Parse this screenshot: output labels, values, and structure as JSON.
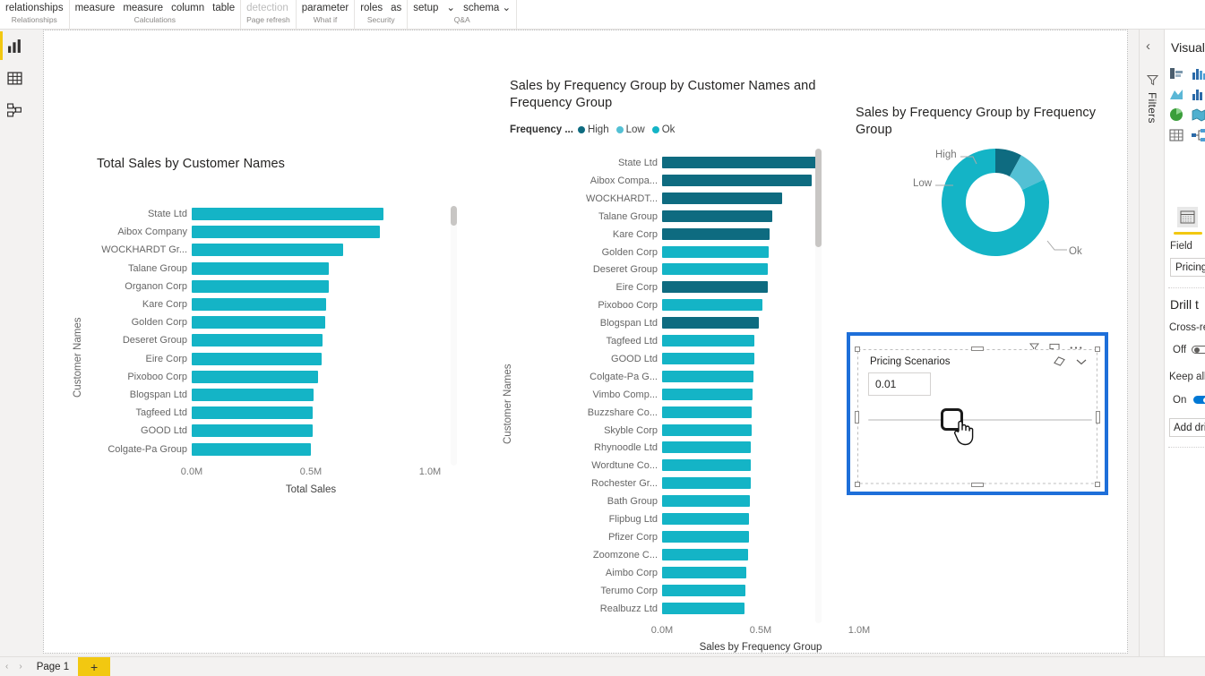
{
  "ribbon": {
    "groups": [
      {
        "caption": "Relationships",
        "items": [
          {
            "label": "relationships",
            "disabled": false
          }
        ]
      },
      {
        "caption": "Calculations",
        "items": [
          {
            "label": "measure",
            "disabled": false
          },
          {
            "label": "measure",
            "disabled": false
          },
          {
            "label": "column",
            "disabled": false
          },
          {
            "label": "table",
            "disabled": false
          }
        ]
      },
      {
        "caption": "Page refresh",
        "items": [
          {
            "label": "detection",
            "disabled": true
          }
        ]
      },
      {
        "caption": "What if",
        "items": [
          {
            "label": "parameter",
            "disabled": false
          }
        ]
      },
      {
        "caption": "Security",
        "items": [
          {
            "label": "roles",
            "disabled": false
          },
          {
            "label": "as",
            "disabled": false
          }
        ]
      },
      {
        "caption": "Q&A",
        "items": [
          {
            "label": "setup",
            "disabled": false
          },
          {
            "label": "⌄",
            "disabled": false
          },
          {
            "label": "schema ⌄",
            "disabled": false
          }
        ]
      }
    ]
  },
  "left_nav": {
    "items": [
      {
        "name": "report-view",
        "icon": "bar-chart-icon",
        "active": true
      },
      {
        "name": "data-view",
        "icon": "table-icon",
        "active": false
      },
      {
        "name": "model-view",
        "icon": "relationships-icon",
        "active": false
      }
    ]
  },
  "chart_data": [
    {
      "type": "bar",
      "title": "Total Sales by Customer Names",
      "orientation": "horizontal",
      "xlabel": "Total Sales",
      "ylabel": "Customer Names",
      "xticks": [
        "0.0M",
        "0.5M",
        "1.0M"
      ],
      "xlim": [
        0,
        1.0
      ],
      "grid": false,
      "color": "#14B4C6",
      "categories": [
        "State Ltd",
        "Aibox Company",
        "WOCKHARDT Gr...",
        "Talane Group",
        "Organon Corp",
        "Kare Corp",
        "Golden Corp",
        "Deseret Group",
        "Eire Corp",
        "Pixoboo Corp",
        "Blogspan Ltd",
        "Tagfeed Ltd",
        "GOOD Ltd",
        "Colgate-Pa Group"
      ],
      "values": [
        0.805,
        0.79,
        0.635,
        0.575,
        0.575,
        0.565,
        0.56,
        0.55,
        0.545,
        0.53,
        0.51,
        0.508,
        0.506,
        0.5
      ]
    },
    {
      "type": "bar",
      "title": "Sales by Frequency Group by Customer Names and Frequency Group",
      "orientation": "horizontal",
      "xlabel": "Sales by Frequency Group",
      "ylabel": "Customer Names",
      "xticks": [
        "0.0M",
        "0.5M",
        "1.0M"
      ],
      "xlim": [
        0,
        1.0
      ],
      "grid": false,
      "legend": {
        "title": "Frequency ...",
        "position": "top",
        "entries": [
          {
            "label": "High",
            "color": "#0E6B80"
          },
          {
            "label": "Low",
            "color": "#53C0D4"
          },
          {
            "label": "Ok",
            "color": "#14B4C6"
          }
        ]
      },
      "categories": [
        "State Ltd",
        "Aibox Compa...",
        "WOCKHARDT...",
        "Talane Group",
        "Kare Corp",
        "Golden Corp",
        "Deseret Group",
        "Eire Corp",
        "Pixoboo Corp",
        "Blogspan Ltd",
        "Tagfeed Ltd",
        "GOOD Ltd",
        "Colgate-Pa G...",
        "Vimbo Comp...",
        "Buzzshare Co...",
        "Skyble Corp",
        "Rhynoodle Ltd",
        "Wordtune Co...",
        "Rochester Gr...",
        "Bath Group",
        "Flipbug Ltd",
        "Pfizer Corp",
        "Zoomzone C...",
        "Aimbo Corp",
        "Terumo Corp",
        "Realbuzz Ltd"
      ],
      "values": [
        0.79,
        0.76,
        0.61,
        0.56,
        0.545,
        0.54,
        0.535,
        0.535,
        0.51,
        0.49,
        0.47,
        0.47,
        0.465,
        0.46,
        0.455,
        0.455,
        0.45,
        0.45,
        0.448,
        0.445,
        0.442,
        0.44,
        0.438,
        0.425,
        0.422,
        0.418
      ],
      "group": [
        "High",
        "High",
        "High",
        "High",
        "High",
        "Ok",
        "Ok",
        "High",
        "Ok",
        "High",
        "Ok",
        "Ok",
        "Ok",
        "Ok",
        "Ok",
        "Ok",
        "Ok",
        "Ok",
        "Ok",
        "Ok",
        "Ok",
        "Ok",
        "Ok",
        "Ok",
        "Ok",
        "Ok"
      ]
    },
    {
      "type": "pie",
      "subtype": "donut",
      "title": "Sales by Frequency Group by Frequency Group",
      "labels": [
        "High",
        "Low",
        "Ok"
      ],
      "values": [
        8,
        10,
        82
      ],
      "colors": [
        "#0E6B80",
        "#53C0D4",
        "#14B4C6"
      ]
    }
  ],
  "slicer": {
    "name": "pricing-scenarios-slicer",
    "title": "Pricing Scenarios",
    "value": "0.01",
    "selected": true,
    "selection_color": "#1e6fd9",
    "header_icons": [
      "filter-icon",
      "focus-mode-icon",
      "more-options-icon"
    ],
    "card_icons": [
      "clear-selection-icon",
      "chevron-down-icon"
    ]
  },
  "filters_rail": {
    "collapse_label": "‹",
    "label": "Filters",
    "icon": "filter-funnel-icon"
  },
  "viz_pane": {
    "title": "Visual",
    "icons": [
      "stacked-bar-chart-icon",
      "clustered-column-chart-icon",
      "line-chart-icon",
      "area-chart-icon",
      "column-chart-icon",
      "funnel-chart-icon",
      "pie-chart-icon",
      "map-icon",
      "card-icon",
      "table-icon",
      "decomposition-tree-icon",
      "qa-icon"
    ],
    "selected_icon": "slicer-icon",
    "field_label": "Field",
    "field_value": "Pricing S",
    "drill_heading": "Drill t",
    "cross_report_label": "Cross-rep",
    "cross_report_state": "Off",
    "keep_all_label": "Keep all",
    "keep_all_state": "On",
    "add_drill_label": "Add dril"
  },
  "bottom_bar": {
    "prev_label": "‹",
    "next_label": "›",
    "page_tab": "Page 1",
    "add_page_label": "+",
    "add_page_color": "#f2c811"
  }
}
